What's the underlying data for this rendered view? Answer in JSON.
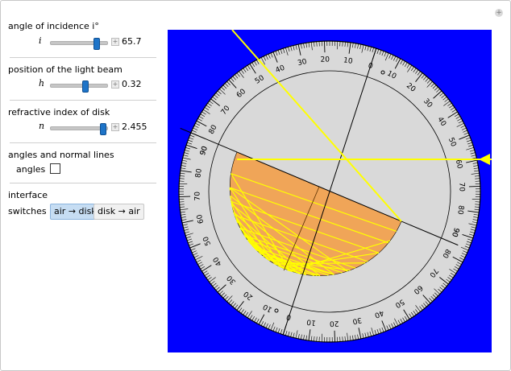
{
  "controls": {
    "angle": {
      "title": "angle of incidence i°",
      "var": "i",
      "value": "65.7",
      "fraction": 0.82
    },
    "position": {
      "title": "position of the light beam",
      "var": "h",
      "value": "0.32",
      "fraction": 0.62
    },
    "index": {
      "title": "refractive index of disk",
      "var": "n",
      "value": "2.455",
      "fraction": 0.93
    },
    "angles": {
      "title": "angles and normal lines",
      "checkbox_label": "angles",
      "checked": false
    },
    "interface": {
      "title": "interface",
      "switch_label": "switches",
      "options": [
        "air → disk",
        "disk → air"
      ],
      "selected": "air → disk"
    }
  },
  "plus_icon": "+",
  "add_control_icon": "+",
  "scene": {
    "background": "#0000ff",
    "protractor_color": "#d9d9d9",
    "disk_color": "#f0a558",
    "ray_color": "#ffff00",
    "dial_numbers": [
      "90",
      "80",
      "70",
      "60",
      "50",
      "40",
      "30",
      "20",
      "10",
      "0",
      "10",
      "20",
      "30",
      "40",
      "50",
      "60",
      "70",
      "80",
      "90"
    ]
  }
}
